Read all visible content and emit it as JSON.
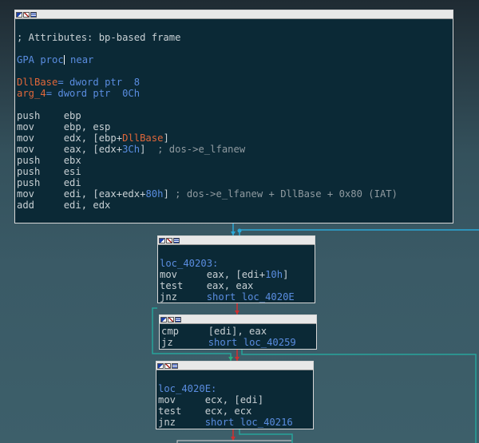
{
  "colors": {
    "background_top": "#1f2b33",
    "background_bottom": "#3d5f6a",
    "node_bg": "#0b2936",
    "node_border": "#d6d6d6",
    "text": "#c8d0d4",
    "keyword_blue": "#5a8de0",
    "name_red": "#e0673a",
    "comment_gray": "#8f9aa0",
    "edge_blue": "#2aa8d8",
    "edge_red": "#d03030",
    "edge_green": "#29b07a",
    "edge_teal": "#27a39a"
  },
  "nodes": [
    {
      "id": "block-0",
      "lines": [
        [],
        [
          {
            "t": "; Attributes: bp-based frame",
            "c": "black"
          }
        ],
        [],
        [
          {
            "t": "GPA proc",
            "c": "blue"
          },
          {
            "cursor": true
          },
          {
            "t": " near",
            "c": "blue"
          }
        ],
        [],
        [
          {
            "t": "DllBase",
            "c": "red"
          },
          {
            "t": "= dword ptr  8",
            "c": "blue"
          }
        ],
        [
          {
            "t": "arg_4",
            "c": "red"
          },
          {
            "t": "= dword ptr  0Ch",
            "c": "blue"
          }
        ],
        [],
        [
          {
            "t": "push    ebp",
            "c": "black"
          }
        ],
        [
          {
            "t": "mov     ebp, esp",
            "c": "black"
          }
        ],
        [
          {
            "t": "mov     edx, [ebp+",
            "c": "black"
          },
          {
            "t": "DllBase",
            "c": "red"
          },
          {
            "t": "]",
            "c": "black"
          }
        ],
        [
          {
            "t": "mov     eax, [edx+",
            "c": "black"
          },
          {
            "t": "3Ch",
            "c": "blue"
          },
          {
            "t": "]  ",
            "c": "black"
          },
          {
            "t": "; dos->e_lfanew",
            "c": "gray"
          }
        ],
        [
          {
            "t": "push    ebx",
            "c": "black"
          }
        ],
        [
          {
            "t": "push    esi",
            "c": "black"
          }
        ],
        [
          {
            "t": "push    edi",
            "c": "black"
          }
        ],
        [
          {
            "t": "mov     edi, [eax+edx+",
            "c": "black"
          },
          {
            "t": "80h",
            "c": "blue"
          },
          {
            "t": "] ",
            "c": "black"
          },
          {
            "t": "; dos->e_lfanew + DllBase + 0x80 (IAT)",
            "c": "gray"
          }
        ],
        [
          {
            "t": "add     edi, edx",
            "c": "black"
          }
        ]
      ]
    },
    {
      "id": "block-loc_40203",
      "lines": [
        [],
        [
          {
            "t": "loc_40203:",
            "c": "blue"
          }
        ],
        [
          {
            "t": "mov     eax, [edi+",
            "c": "black"
          },
          {
            "t": "10h",
            "c": "blue"
          },
          {
            "t": "]",
            "c": "black"
          }
        ],
        [
          {
            "t": "test    eax, eax",
            "c": "black"
          }
        ],
        [
          {
            "t": "jnz     ",
            "c": "black"
          },
          {
            "t": "short loc_4020E",
            "c": "blue"
          }
        ]
      ]
    },
    {
      "id": "block-cmp",
      "lines": [
        [
          {
            "t": "cmp     [edi], eax",
            "c": "black"
          }
        ],
        [
          {
            "t": "jz      ",
            "c": "black"
          },
          {
            "t": "short loc_40259",
            "c": "blue"
          }
        ]
      ]
    },
    {
      "id": "block-loc_4020E",
      "lines": [
        [],
        [
          {
            "t": "loc_4020E:",
            "c": "blue"
          }
        ],
        [
          {
            "t": "mov     ecx, [edi]",
            "c": "black"
          }
        ],
        [
          {
            "t": "test    ecx, ecx",
            "c": "black"
          }
        ],
        [
          {
            "t": "jnz     ",
            "c": "black"
          },
          {
            "t": "short loc_40216",
            "c": "blue"
          }
        ]
      ]
    }
  ]
}
